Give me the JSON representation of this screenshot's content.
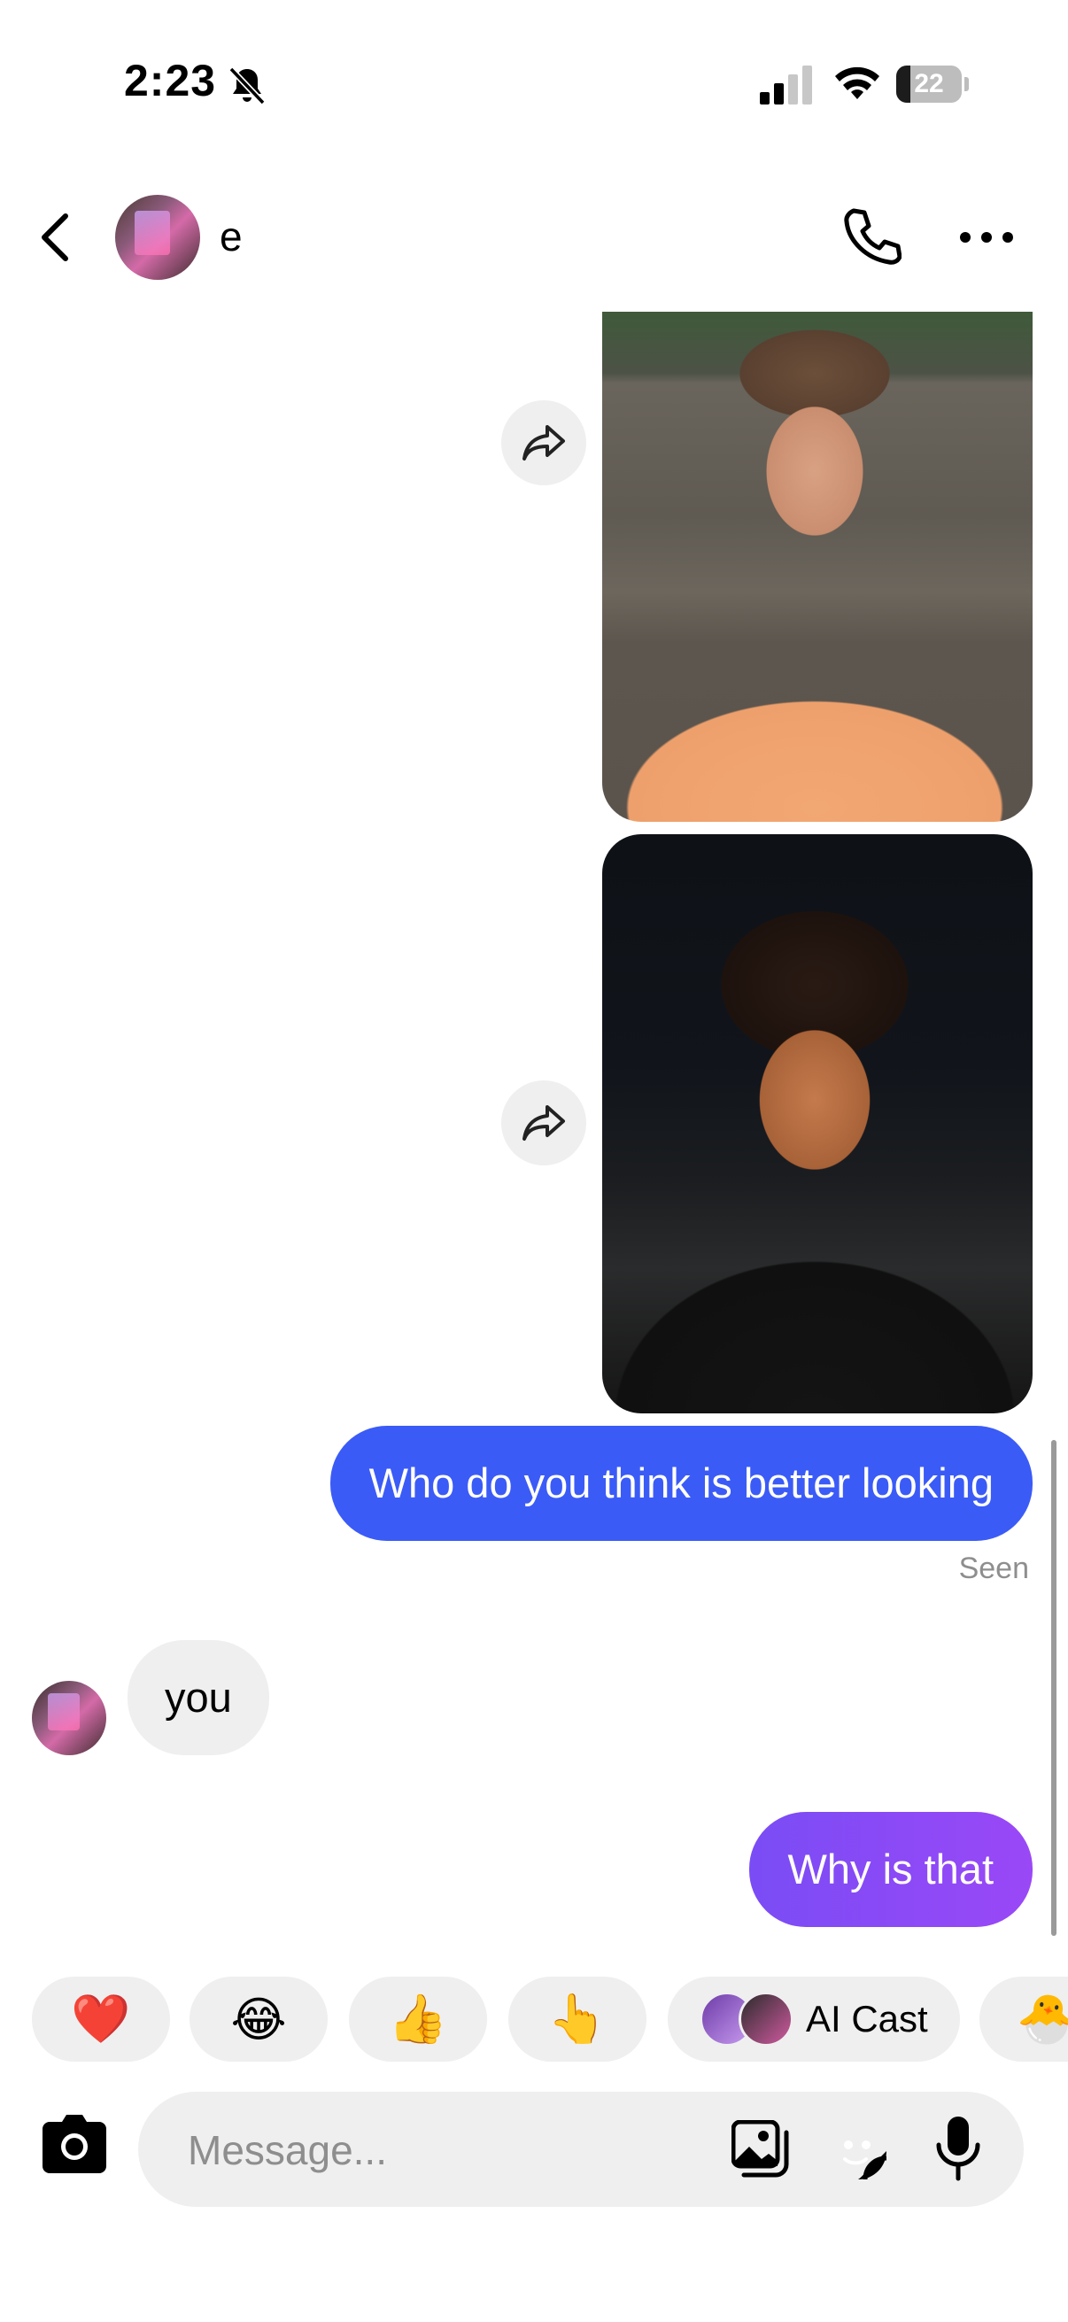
{
  "status_bar": {
    "time": "2:23",
    "battery": "22",
    "battery_level_percent": 22,
    "icons": [
      "bell-slash-icon",
      "cellular-signal-icon",
      "wifi-icon",
      "battery-icon"
    ]
  },
  "header": {
    "contact_name": "e",
    "icons": [
      "back-chevron-icon",
      "phone-icon",
      "more-horizontal-icon"
    ]
  },
  "messages": [
    {
      "type": "photo",
      "direction": "sent"
    },
    {
      "type": "photo",
      "direction": "sent"
    },
    {
      "type": "text",
      "direction": "sent",
      "text": "Who do you think is better looking",
      "color": "#3b5bf7"
    },
    {
      "type": "receipt",
      "text": "Seen"
    },
    {
      "type": "text",
      "direction": "received",
      "text": "you"
    },
    {
      "type": "text",
      "direction": "sent",
      "text": "Why is that",
      "color": "#8a4af6"
    }
  ],
  "quick_reactions": [
    {
      "emoji": "❤️"
    },
    {
      "emoji": "😂"
    },
    {
      "emoji": "👍"
    },
    {
      "emoji": "👆"
    },
    {
      "label": "AI Cast"
    },
    {
      "emoji": "🐣"
    }
  ],
  "composer": {
    "placeholder": "Message...",
    "value": "",
    "icons": [
      "camera-icon",
      "gallery-icon",
      "sticker-icon",
      "microphone-icon"
    ]
  }
}
